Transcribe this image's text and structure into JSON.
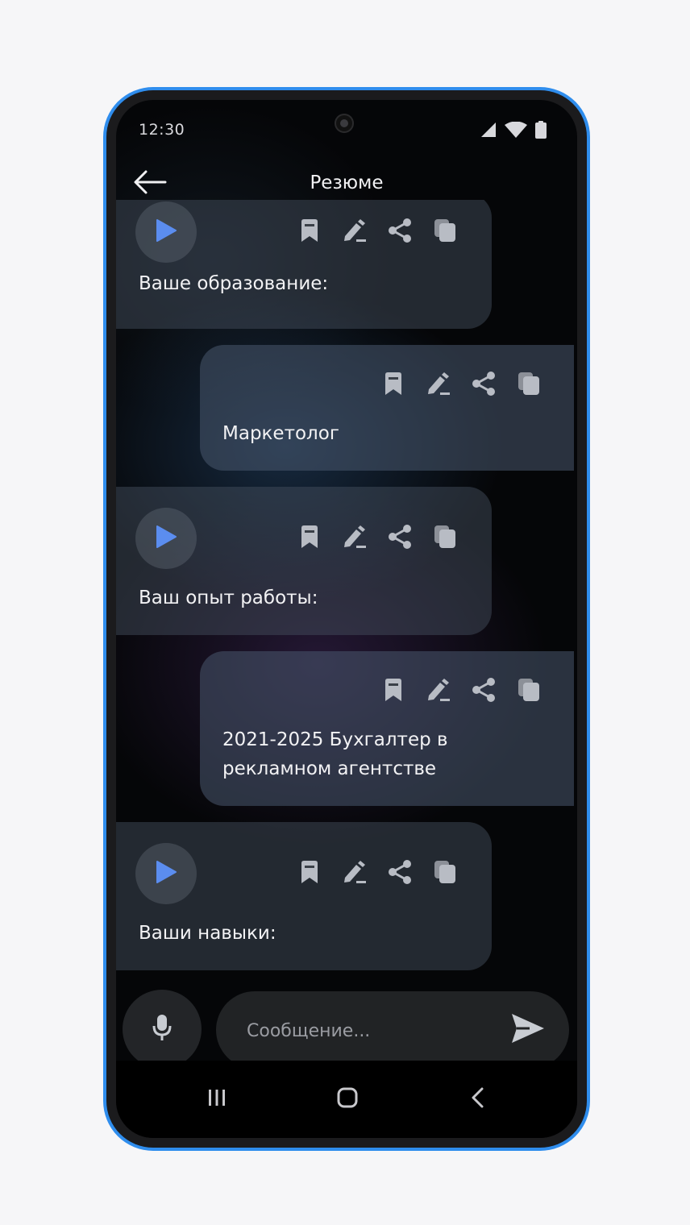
{
  "status_bar": {
    "time": "12:30",
    "icons": [
      "signal-icon",
      "wifi-icon",
      "battery-icon"
    ]
  },
  "header": {
    "title": "Резюме",
    "back_icon": "arrow-left-icon"
  },
  "messages": [
    {
      "role": "bot",
      "text": "Ваше образование:",
      "has_play": true
    },
    {
      "role": "user",
      "text": "Маркетолог",
      "has_play": false
    },
    {
      "role": "bot",
      "text": "Ваш опыт работы:",
      "has_play": true
    },
    {
      "role": "user",
      "text": "2021-2025 Бухгалтер в рекламном агентстве",
      "has_play": false
    },
    {
      "role": "bot",
      "text": "Ваши навыки:",
      "has_play": true
    }
  ],
  "message_actions": [
    "bookmark-icon",
    "edit-icon",
    "share-icon",
    "copy-icon"
  ],
  "composer": {
    "placeholder": "Сообщение...",
    "mic_icon": "microphone-icon",
    "send_icon": "send-icon"
  },
  "nav_bar": {
    "icons": [
      "recent-apps-icon",
      "home-icon",
      "back-icon"
    ]
  },
  "colors": {
    "accent": "#2f8ded",
    "play": "#5b8def",
    "icon_gray": "#b8bcc4"
  }
}
